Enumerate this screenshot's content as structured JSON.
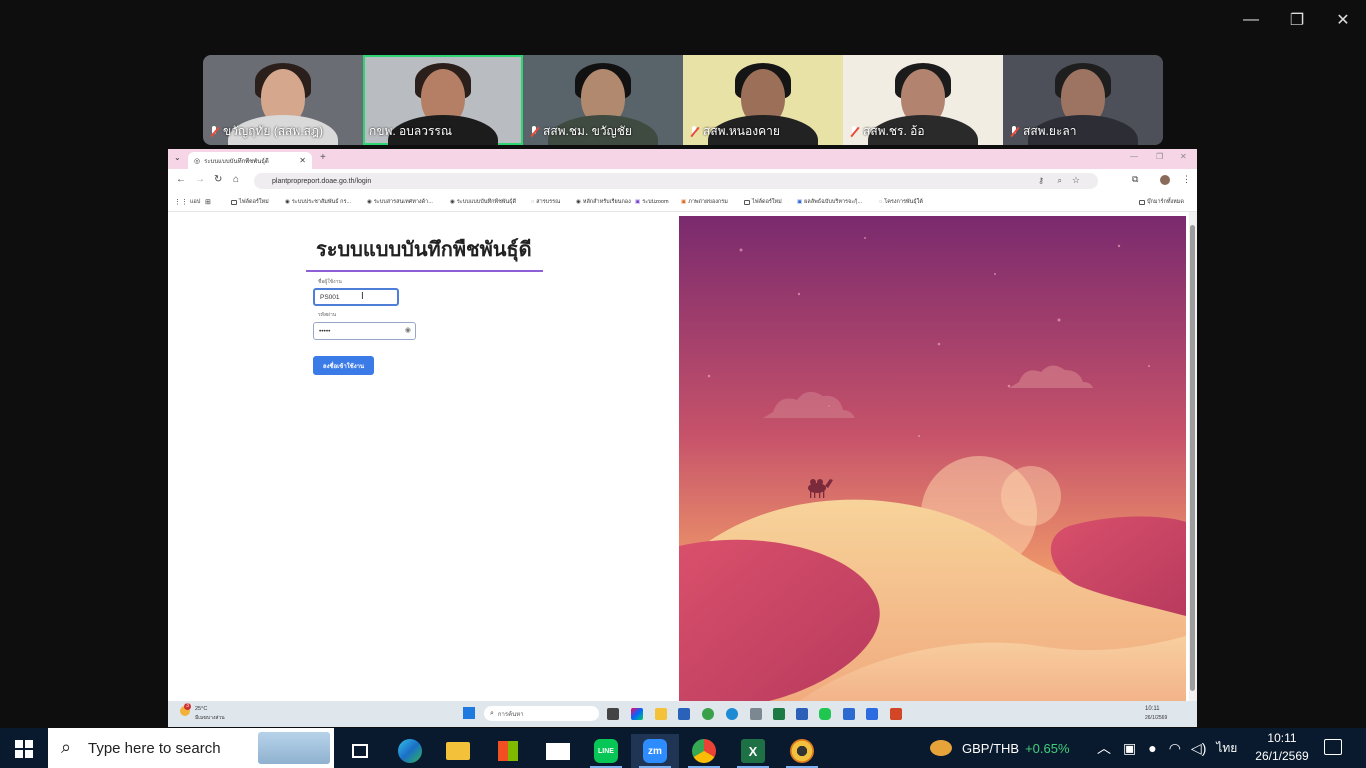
{
  "window_controls": {
    "minimize": "—",
    "restore": "❐",
    "close": "✕"
  },
  "participants": [
    {
      "name": "ขวัญฤทัย (สสพ.สฎ)",
      "muted": true,
      "active": false
    },
    {
      "name": "กขพ. อบลวรรณ",
      "muted": false,
      "active": true
    },
    {
      "name": "สสพ.ชม. ขวัญชัย",
      "muted": true,
      "active": false
    },
    {
      "name": "สสพ.หนองคาย",
      "muted": true,
      "active": false
    },
    {
      "name": "สสพ.ชร. อ้อ",
      "muted": true,
      "active": false
    },
    {
      "name": "สสพ.ยะลา",
      "muted": true,
      "active": false
    }
  ],
  "browser": {
    "tab_title": "ระบบแบบบันทึกพืชพันธุ์ดี",
    "url": "plantpropreport.doae.go.th/login",
    "bookmarks": [
      "แอป",
      "ไฟล์ดอร์ใหม่",
      "ระบบประชาสัมพันธ์ กร...",
      "ระบบสารสนเทศทางด้า...",
      "ระบบแบบบันทึกพืชพันธุ์ดี",
      "สารบรรณ",
      "หลักสำหรับเรียนกอง",
      "ระบบzoom",
      "ภาพถ่ายของกรม",
      "ไฟล์ดอร์ใหม่",
      "ผลลัพธ์ฉบับบริหารจะกุ้...",
      "โครงการพันธุ์ใต้"
    ],
    "bookmarks_right": "บุ๊กมาร์กทั้งหมด"
  },
  "login": {
    "title": "ระบบแบบบันทึกพืชพันธุ์ดี",
    "username_label": "ชื่อผู้ใช้งาน",
    "username_value": "PS001",
    "password_label": "รหัสผ่าน",
    "password_value": "•••••",
    "submit_label": "ลงชื่อเข้าใช้งาน"
  },
  "inner_taskbar": {
    "weather_temp": "25°C",
    "weather_desc": "มีเมฆบางส่วน",
    "weather_badge": "3",
    "search_placeholder": "การค้นหา",
    "time": "10:11",
    "date": "26/1/2569"
  },
  "taskbar": {
    "search_placeholder": "Type here to search",
    "ticker_pair": "GBP/THB",
    "ticker_change": "+0.65%",
    "language": "ไทย",
    "time": "10:11",
    "date": "26/1/2569"
  },
  "colors": {
    "accent": "#3b7be8",
    "active_tile": "#2ed573",
    "ticker_up": "#3fd07a",
    "title_underline": "#8e5fd6",
    "tab_strip": "#f6d6e6"
  }
}
